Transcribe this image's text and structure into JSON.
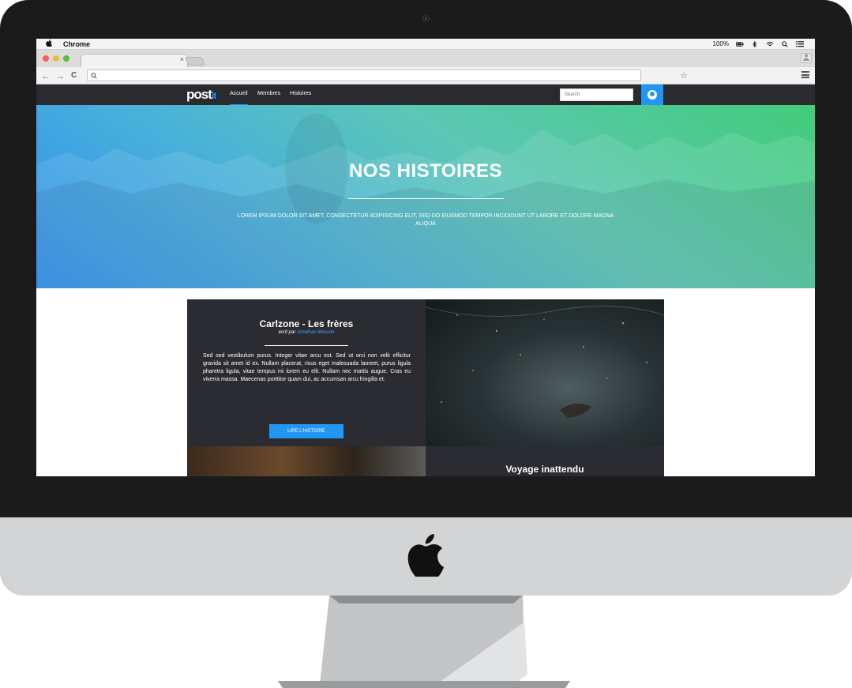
{
  "menubar": {
    "app_name": "Chrome",
    "battery": "100%"
  },
  "browser": {
    "tab_close": "×",
    "address_value": "",
    "back_glyph": "←",
    "forward_glyph": "→",
    "reload_glyph": "C",
    "star_glyph": "☆"
  },
  "site": {
    "logo_main": "post",
    "logo_suffix": "it",
    "nav": [
      "Accueil",
      "Membres",
      "Histoires"
    ],
    "active_nav": "Accueil",
    "search_placeholder": "Search",
    "accent": "#2196f3"
  },
  "hero": {
    "title": "NOS HISTOIRES",
    "subtitle": "LOREM IPSUM DOLOR SIT AMET, CONSECTETUR ADIPISICING ELIT, SED DO EIUSMOD TEMPOR INCIDIDUNT UT LABORE ET DOLORE MAGNA ALIQUA"
  },
  "stories": [
    {
      "title": "Carlzone - Les frères",
      "written_by": "écrit par",
      "author": "Jonathan Masson",
      "body": "Sed sed vestibulum purus. Integer vitae arcu est. Sed ut orci non velit efficitur gravida sit amet id ex. Nullam placerat, risus eget malesuada laoreet, purus ligula pharetra ligula, vitae tempus mi lorem eu elit. Nullam nec mattis augue. Cras eu viverra massa. Maecenas porttitor quam dui, ac accumsan arcu fringilla et.",
      "button": "LIRE L'HISTOIRE"
    },
    {
      "title": "Voyage inattendu"
    }
  ]
}
